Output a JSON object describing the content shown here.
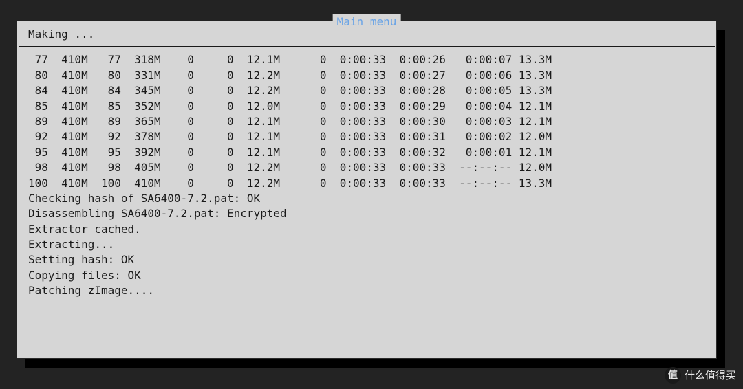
{
  "window": {
    "title": "Main menu",
    "header": "Making ..."
  },
  "download_rows": [
    {
      "pct1": "77",
      "total": "410M",
      "pct2": "77",
      "xferd": "318M",
      "z1": "0",
      "z2": "0",
      "avg": "12.1M",
      "z3": "0",
      "t_total": "0:00:33",
      "t_spent": "0:00:26",
      "t_left": "0:00:07",
      "speed": "13.3M"
    },
    {
      "pct1": "80",
      "total": "410M",
      "pct2": "80",
      "xferd": "331M",
      "z1": "0",
      "z2": "0",
      "avg": "12.2M",
      "z3": "0",
      "t_total": "0:00:33",
      "t_spent": "0:00:27",
      "t_left": "0:00:06",
      "speed": "13.3M"
    },
    {
      "pct1": "84",
      "total": "410M",
      "pct2": "84",
      "xferd": "345M",
      "z1": "0",
      "z2": "0",
      "avg": "12.2M",
      "z3": "0",
      "t_total": "0:00:33",
      "t_spent": "0:00:28",
      "t_left": "0:00:05",
      "speed": "13.3M"
    },
    {
      "pct1": "85",
      "total": "410M",
      "pct2": "85",
      "xferd": "352M",
      "z1": "0",
      "z2": "0",
      "avg": "12.0M",
      "z3": "0",
      "t_total": "0:00:33",
      "t_spent": "0:00:29",
      "t_left": "0:00:04",
      "speed": "12.1M"
    },
    {
      "pct1": "89",
      "total": "410M",
      "pct2": "89",
      "xferd": "365M",
      "z1": "0",
      "z2": "0",
      "avg": "12.1M",
      "z3": "0",
      "t_total": "0:00:33",
      "t_spent": "0:00:30",
      "t_left": "0:00:03",
      "speed": "12.1M"
    },
    {
      "pct1": "92",
      "total": "410M",
      "pct2": "92",
      "xferd": "378M",
      "z1": "0",
      "z2": "0",
      "avg": "12.1M",
      "z3": "0",
      "t_total": "0:00:33",
      "t_spent": "0:00:31",
      "t_left": "0:00:02",
      "speed": "12.0M"
    },
    {
      "pct1": "95",
      "total": "410M",
      "pct2": "95",
      "xferd": "392M",
      "z1": "0",
      "z2": "0",
      "avg": "12.1M",
      "z3": "0",
      "t_total": "0:00:33",
      "t_spent": "0:00:32",
      "t_left": "0:00:01",
      "speed": "12.1M"
    },
    {
      "pct1": "98",
      "total": "410M",
      "pct2": "98",
      "xferd": "405M",
      "z1": "0",
      "z2": "0",
      "avg": "12.2M",
      "z3": "0",
      "t_total": "0:00:33",
      "t_spent": "0:00:33",
      "t_left": "--:--:--",
      "speed": "12.0M"
    },
    {
      "pct1": "100",
      "total": "410M",
      "pct2": "100",
      "xferd": "410M",
      "z1": "0",
      "z2": "0",
      "avg": "12.2M",
      "z3": "0",
      "t_total": "0:00:33",
      "t_spent": "0:00:33",
      "t_left": "--:--:--",
      "speed": "13.3M"
    }
  ],
  "status_messages": [
    "Checking hash of SA6400-7.2.pat: OK",
    "Disassembling SA6400-7.2.pat: Encrypted",
    "Extractor cached.",
    "Extracting...",
    "Setting hash: OK",
    "Copying files: OK",
    "Patching zImage...."
  ],
  "watermark": {
    "badge": "值",
    "text": "什么值得买"
  }
}
